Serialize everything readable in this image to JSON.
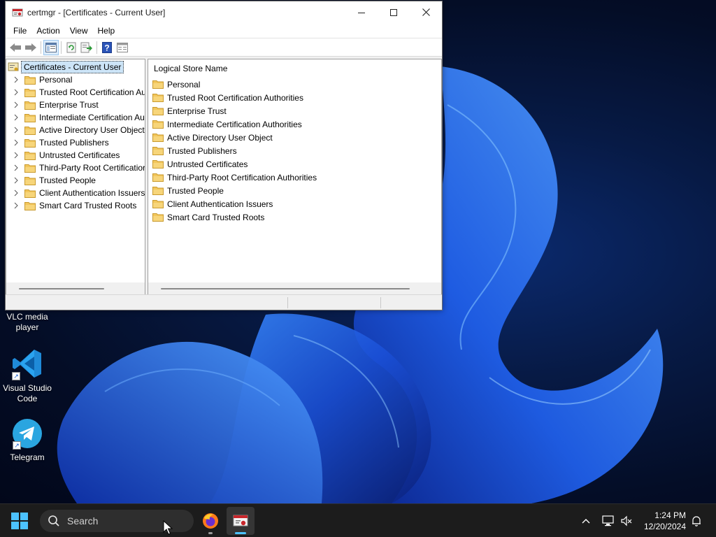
{
  "window": {
    "title": "certmgr - [Certificates - Current User]",
    "menu": [
      "File",
      "Action",
      "View",
      "Help"
    ],
    "toolbar_buttons": [
      "back-arrow-icon",
      "forward-arrow-icon",
      "show-hide-console-tree-icon",
      "refresh-icon",
      "export-list-icon",
      "help-icon",
      "properties-icon"
    ]
  },
  "tree": {
    "root": "Certificates - Current User",
    "items": [
      "Personal",
      "Trusted Root Certification Au",
      "Enterprise Trust",
      "Intermediate Certification Au",
      "Active Directory User Object",
      "Trusted Publishers",
      "Untrusted Certificates",
      "Third-Party Root Certificatior",
      "Trusted People",
      "Client Authentication Issuers",
      "Smart Card Trusted Roots"
    ]
  },
  "list": {
    "header": "Logical Store Name",
    "items": [
      "Personal",
      "Trusted Root Certification Authorities",
      "Enterprise Trust",
      "Intermediate Certification Authorities",
      "Active Directory User Object",
      "Trusted Publishers",
      "Untrusted Certificates",
      "Third-Party Root Certification Authorities",
      "Trusted People",
      "Client Authentication Issuers",
      "Smart Card Trusted Roots"
    ]
  },
  "desktop": {
    "icons": [
      {
        "name": "VLC media player"
      },
      {
        "name": "Visual Studio Code"
      },
      {
        "name": "Telegram"
      }
    ]
  },
  "taskbar": {
    "search_placeholder": "Search",
    "time": "1:24 PM",
    "date": "12/20/2024"
  },
  "colors": {
    "folder": "#e8b94a",
    "accent": "#1a5fd0",
    "selection": "#cce4f7"
  }
}
